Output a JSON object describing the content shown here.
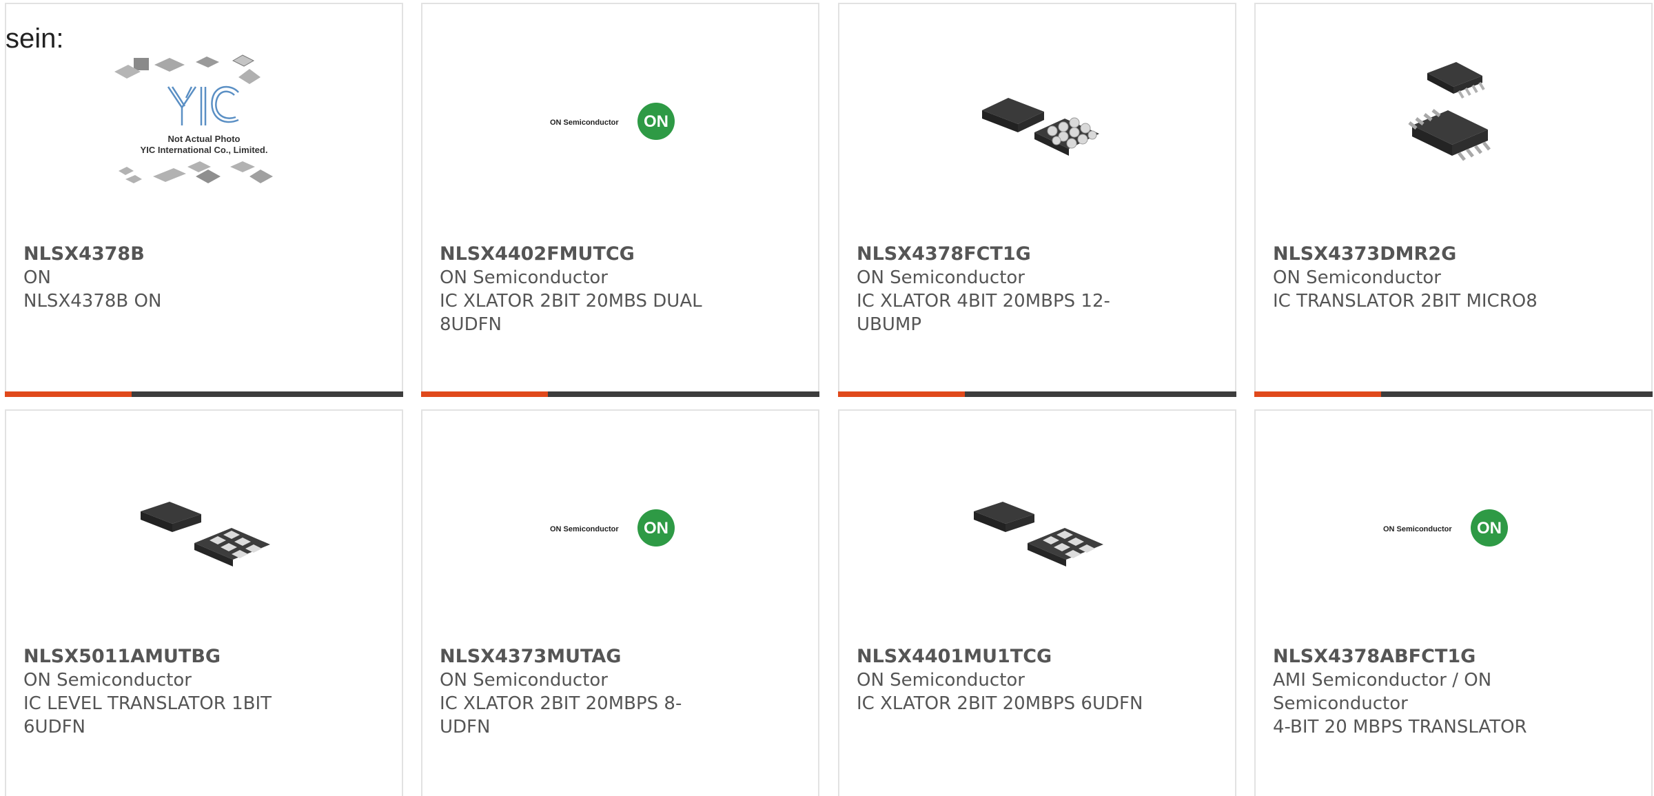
{
  "lead_text": "sein:",
  "products": [
    {
      "part": "NLSX4378B",
      "manufacturer": "ON",
      "description": "NLSX4378B ON",
      "image": "placeholder-not-actual-photo",
      "placeholder_text": {
        "brand": "YIC",
        "line1": "Not Actual Photo",
        "line2": "YIC International Co., Limited."
      }
    },
    {
      "part": "NLSX4402FMUTCG",
      "manufacturer": "ON Semiconductor",
      "description": "IC XLATOR 2BIT 20MBS DUAL 8UDFN",
      "image": "on-semiconductor-logo"
    },
    {
      "part": "NLSX4378FCT1G",
      "manufacturer": "ON Semiconductor",
      "description": "IC XLATOR 4BIT 20MBPS 12-UBUMP",
      "image": "bga-chip"
    },
    {
      "part": "NLSX4373DMR2G",
      "manufacturer": "ON Semiconductor",
      "description": "IC TRANSLATOR 2BIT MICRO8",
      "image": "msop-chip"
    },
    {
      "part": "NLSX5011AMUTBG",
      "manufacturer": "ON Semiconductor",
      "description": "IC LEVEL TRANSLATOR 1BIT 6UDFN",
      "image": "udfn-chip"
    },
    {
      "part": "NLSX4373MUTAG",
      "manufacturer": "ON Semiconductor",
      "description": "IC XLATOR 2BIT 20MBPS 8-UDFN",
      "image": "on-semiconductor-logo"
    },
    {
      "part": "NLSX4401MU1TCG",
      "manufacturer": "ON Semiconductor",
      "description": "IC XLATOR 2BIT 20MBPS 6UDFN",
      "image": "udfn-chip"
    },
    {
      "part": "NLSX4378ABFCT1G",
      "manufacturer": "AMI Semiconductor / ON Semiconductor",
      "description": "4-BIT 20 MBPS TRANSLATOR",
      "image": "on-semiconductor-logo"
    }
  ],
  "logo_text": {
    "brand": "ON Semiconductor",
    "mark": "ON"
  },
  "colors": {
    "accent": "#e0491b",
    "bar": "#3d3d3d",
    "card_border": "#e2e2e2",
    "logo_green": "#2e9a45"
  }
}
